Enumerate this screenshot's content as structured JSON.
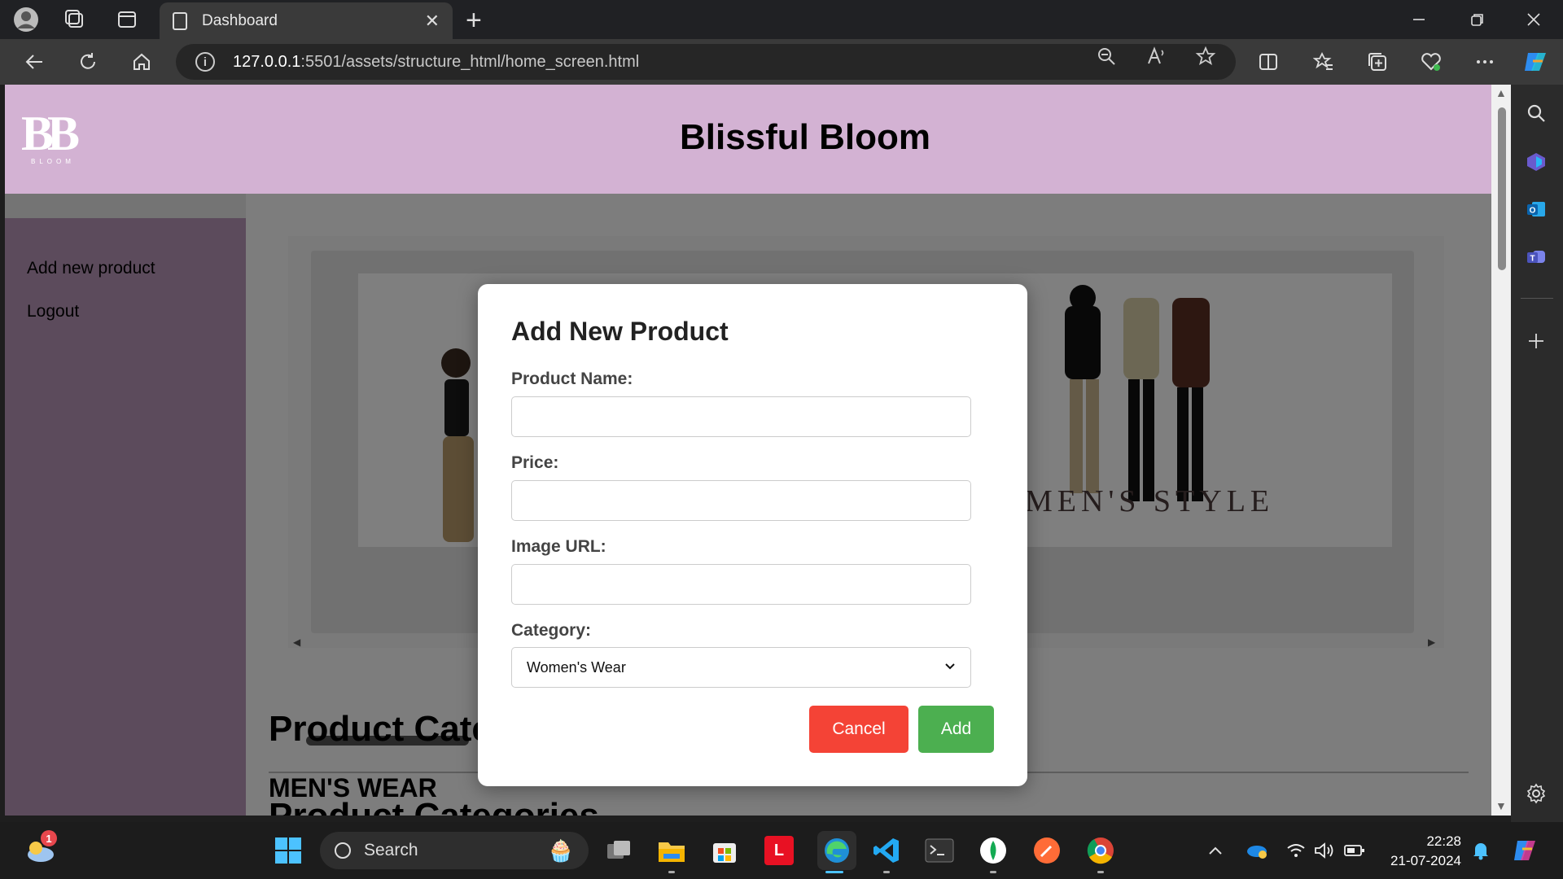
{
  "browser": {
    "tab_title": "Dashboard",
    "tab_close": "✕",
    "new_tab": "+",
    "url_host": "127.0.0.1",
    "url_rest": ":5501/assets/structure_html/home_screen.html"
  },
  "site": {
    "logo_text": "BB",
    "logo_subtext": "BLOOM",
    "title": "Blissful Bloom"
  },
  "menu": {
    "items": [
      "Add new product",
      "Logout"
    ]
  },
  "carousel": {
    "slide_caption": "MEN'S STYLE"
  },
  "content": {
    "section_title": "Product Categories",
    "subsection_title": "MEN'S WEAR"
  },
  "modal": {
    "title": "Add New Product",
    "product_name_label": "Product Name:",
    "product_name_value": "",
    "price_label": "Price:",
    "price_value": "",
    "image_url_label": "Image URL:",
    "image_url_value": "",
    "category_label": "Category:",
    "category_selected": "Women's Wear",
    "cancel_label": "Cancel",
    "add_label": "Add"
  },
  "taskbar": {
    "search_label": "Search",
    "notification_count": "1",
    "time": "22:28",
    "date": "21-07-2024"
  },
  "colors": {
    "header_bg": "#d3b2d3",
    "sidebar_bg": "#b896b9",
    "cancel_button": "#f44336",
    "add_button": "#4caf50"
  }
}
